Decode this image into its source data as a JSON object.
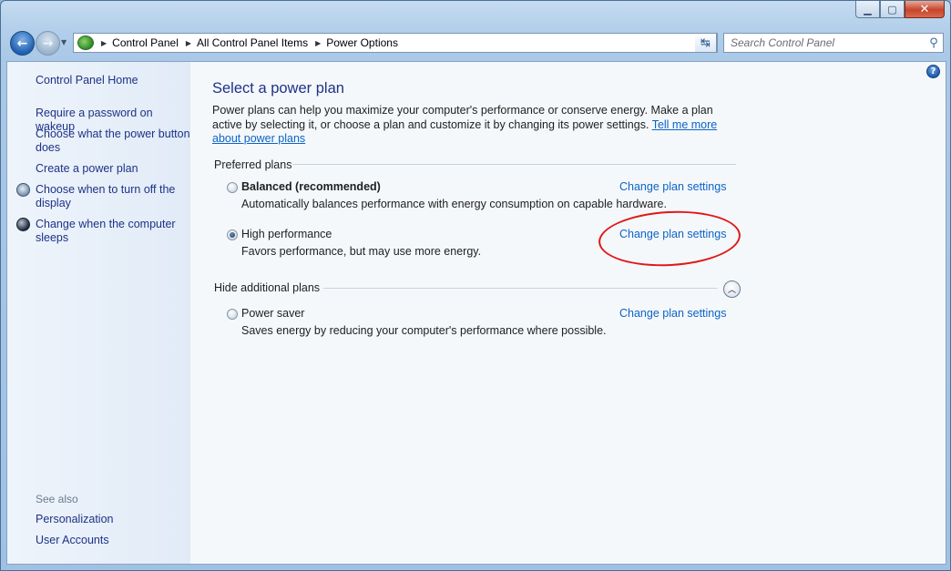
{
  "window": {
    "minimize_glyph": "▁",
    "maximize_glyph": "▢",
    "close_glyph": "✕"
  },
  "nav": {
    "back_glyph": "←",
    "forward_glyph": "→",
    "recent_glyph": "▼"
  },
  "address": {
    "separator_glyph": "▶",
    "crumbs": [
      "Control Panel",
      "All Control Panel Items",
      "Power Options"
    ],
    "dropdown_glyph": "▼",
    "refresh_glyph": "↹"
  },
  "search": {
    "placeholder": "Search Control Panel",
    "icon_glyph": "⚲"
  },
  "sidebar": {
    "home": "Control Panel Home",
    "items": [
      {
        "label": "Require a password on wakeup",
        "icon": ""
      },
      {
        "label": "Choose what the power button does",
        "icon": ""
      },
      {
        "label": "Create a power plan",
        "icon": ""
      },
      {
        "label": "Choose when to turn off the display",
        "icon": "monitor-clock-icon"
      },
      {
        "label": "Change when the computer sleeps",
        "icon": "moon-icon"
      }
    ],
    "see_also": "See also",
    "see_also_items": [
      "Personalization",
      "User Accounts"
    ]
  },
  "main": {
    "help_glyph": "?",
    "title": "Select a power plan",
    "intro": "Power plans can help you maximize your computer's performance or conserve energy. Make a plan active by selecting it, or choose a plan and customize it by changing its power settings. ",
    "intro_link": "Tell me more about power plans",
    "preferred_label": "Preferred plans",
    "hide_label": "Hide additional plans",
    "collapse_glyph": "︿",
    "plans": [
      {
        "name": "Balanced (recommended)",
        "description": "Automatically balances performance with energy consumption on capable hardware.",
        "link": "Change plan settings",
        "selected": false
      },
      {
        "name": "High performance",
        "description": "Favors performance, but may use more energy.",
        "link": "Change plan settings",
        "selected": true
      },
      {
        "name": "Power saver",
        "description": "Saves energy by reducing your computer's performance where possible.",
        "link": "Change plan settings",
        "selected": false
      }
    ]
  },
  "colors": {
    "link": "#0b64c6",
    "title": "#1e3287",
    "annotation": "#e01818"
  }
}
